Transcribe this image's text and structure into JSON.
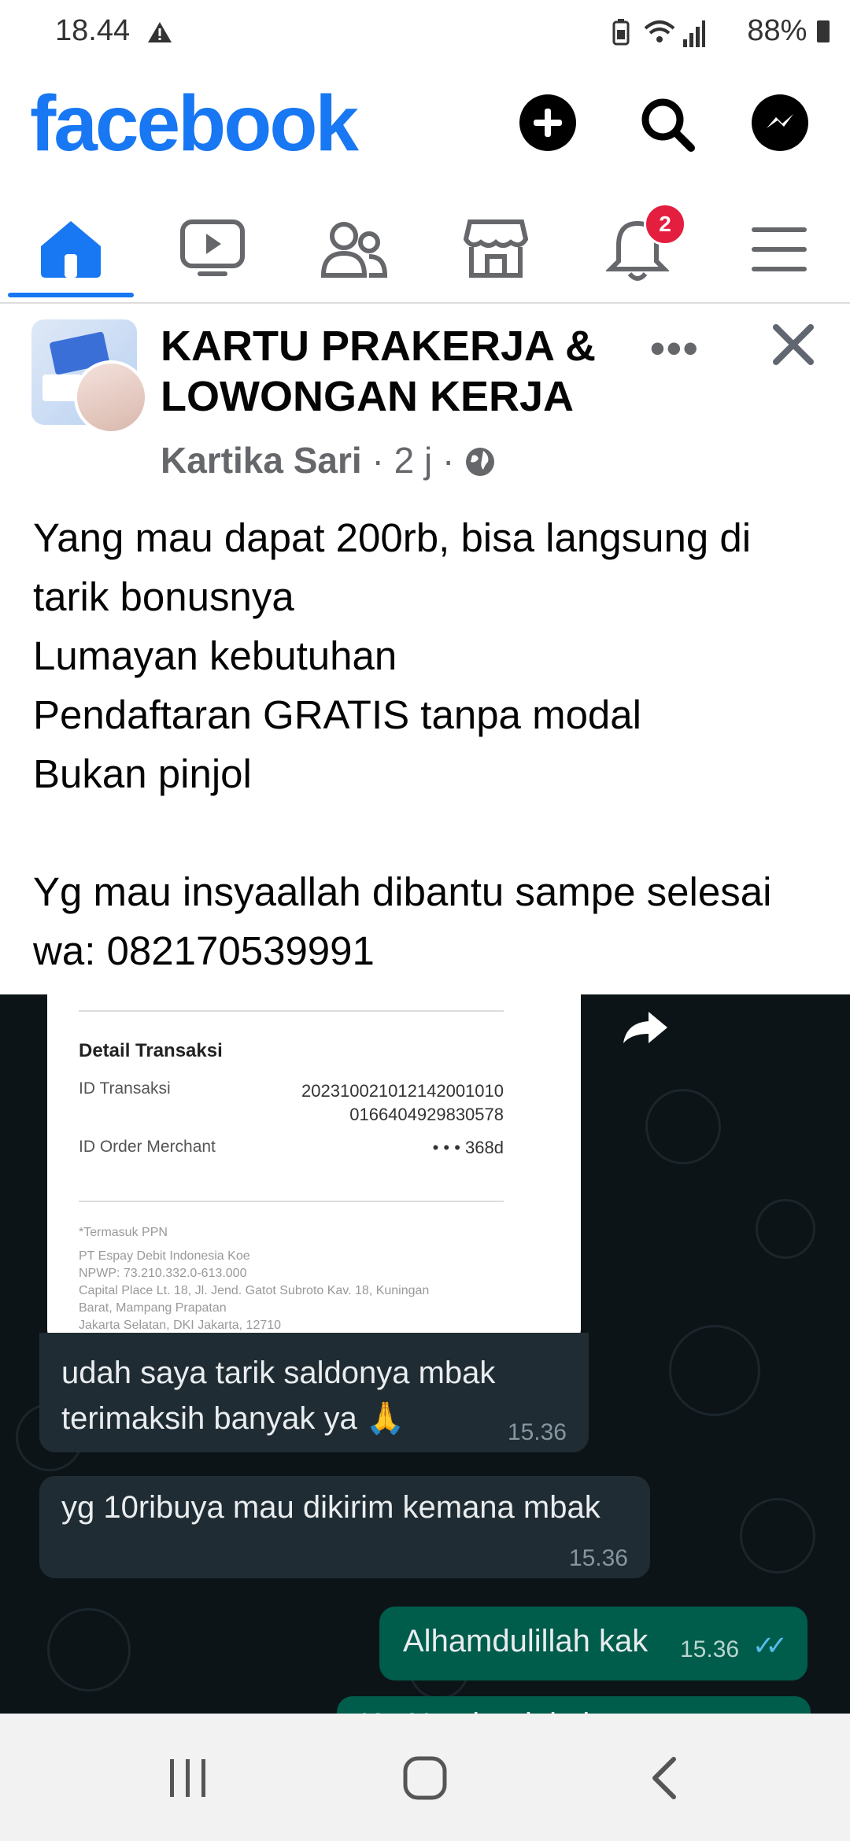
{
  "status": {
    "time": "18.44",
    "battery": "88%"
  },
  "header": {
    "logo": "facebook",
    "icons": [
      "plus-icon",
      "search-icon",
      "messenger-icon"
    ]
  },
  "nav": {
    "tabs": [
      "home-icon",
      "video-icon",
      "friends-icon",
      "marketplace-icon",
      "bell-icon",
      "menu-icon"
    ],
    "notification_count": "2",
    "active_tab": "home"
  },
  "post": {
    "group_name": "KARTU PRAKERJA & LOWONGAN KERJA",
    "author": "Kartika Sari",
    "time": "2 j",
    "separator": "·",
    "text": "Yang mau dapat 200rb, bisa langsung di tarik bonusnya\nLumayan kebutuhan\nPendaftaran GRATIS tanpa modal\nBukan pinjol\n\nYg mau insyaallah dibantu sampe selesai wa: 082170539991"
  },
  "chat_image": {
    "receipt": {
      "section_title": "Detail Transaksi",
      "id_label": "ID Transaksi",
      "id_value_1": "202310021012142001010",
      "id_value_2": "0166404929830578",
      "order_label": "ID Order Merchant",
      "order_value": "• • • 368d",
      "footer_1": "*Termasuk PPN",
      "footer_2": "PT Espay Debit Indonesia Koe",
      "footer_3": "NPWP: 73.210.332.0-613.000",
      "footer_4": "Capital Place Lt. 18, Jl. Jend. Gatot Subroto Kav. 18, Kuningan",
      "footer_5": "Barat, Mampang Prapatan",
      "footer_6": "Jakarta Selatan, DKI Jakarta, 12710"
    },
    "messages": [
      {
        "text_1": "udah saya tarik saldonya mbak",
        "text_2": "terimaksih banyak ya 🙏",
        "time": "15.36"
      },
      {
        "text": "yg 10ribuya mau dikirim kemana mbak",
        "time": "15.36"
      },
      {
        "text": "Alhamdulillah kak",
        "time": "15.36",
        "ticks": "✓✓"
      },
      {
        "text": "Ke Nos bank kak"
      }
    ]
  },
  "colors": {
    "brand": "#1877f2",
    "badge": "#e41e3f",
    "chat_bg": "#0d1418",
    "bubble_in": "#202c33",
    "bubble_out": "#005c4b"
  }
}
